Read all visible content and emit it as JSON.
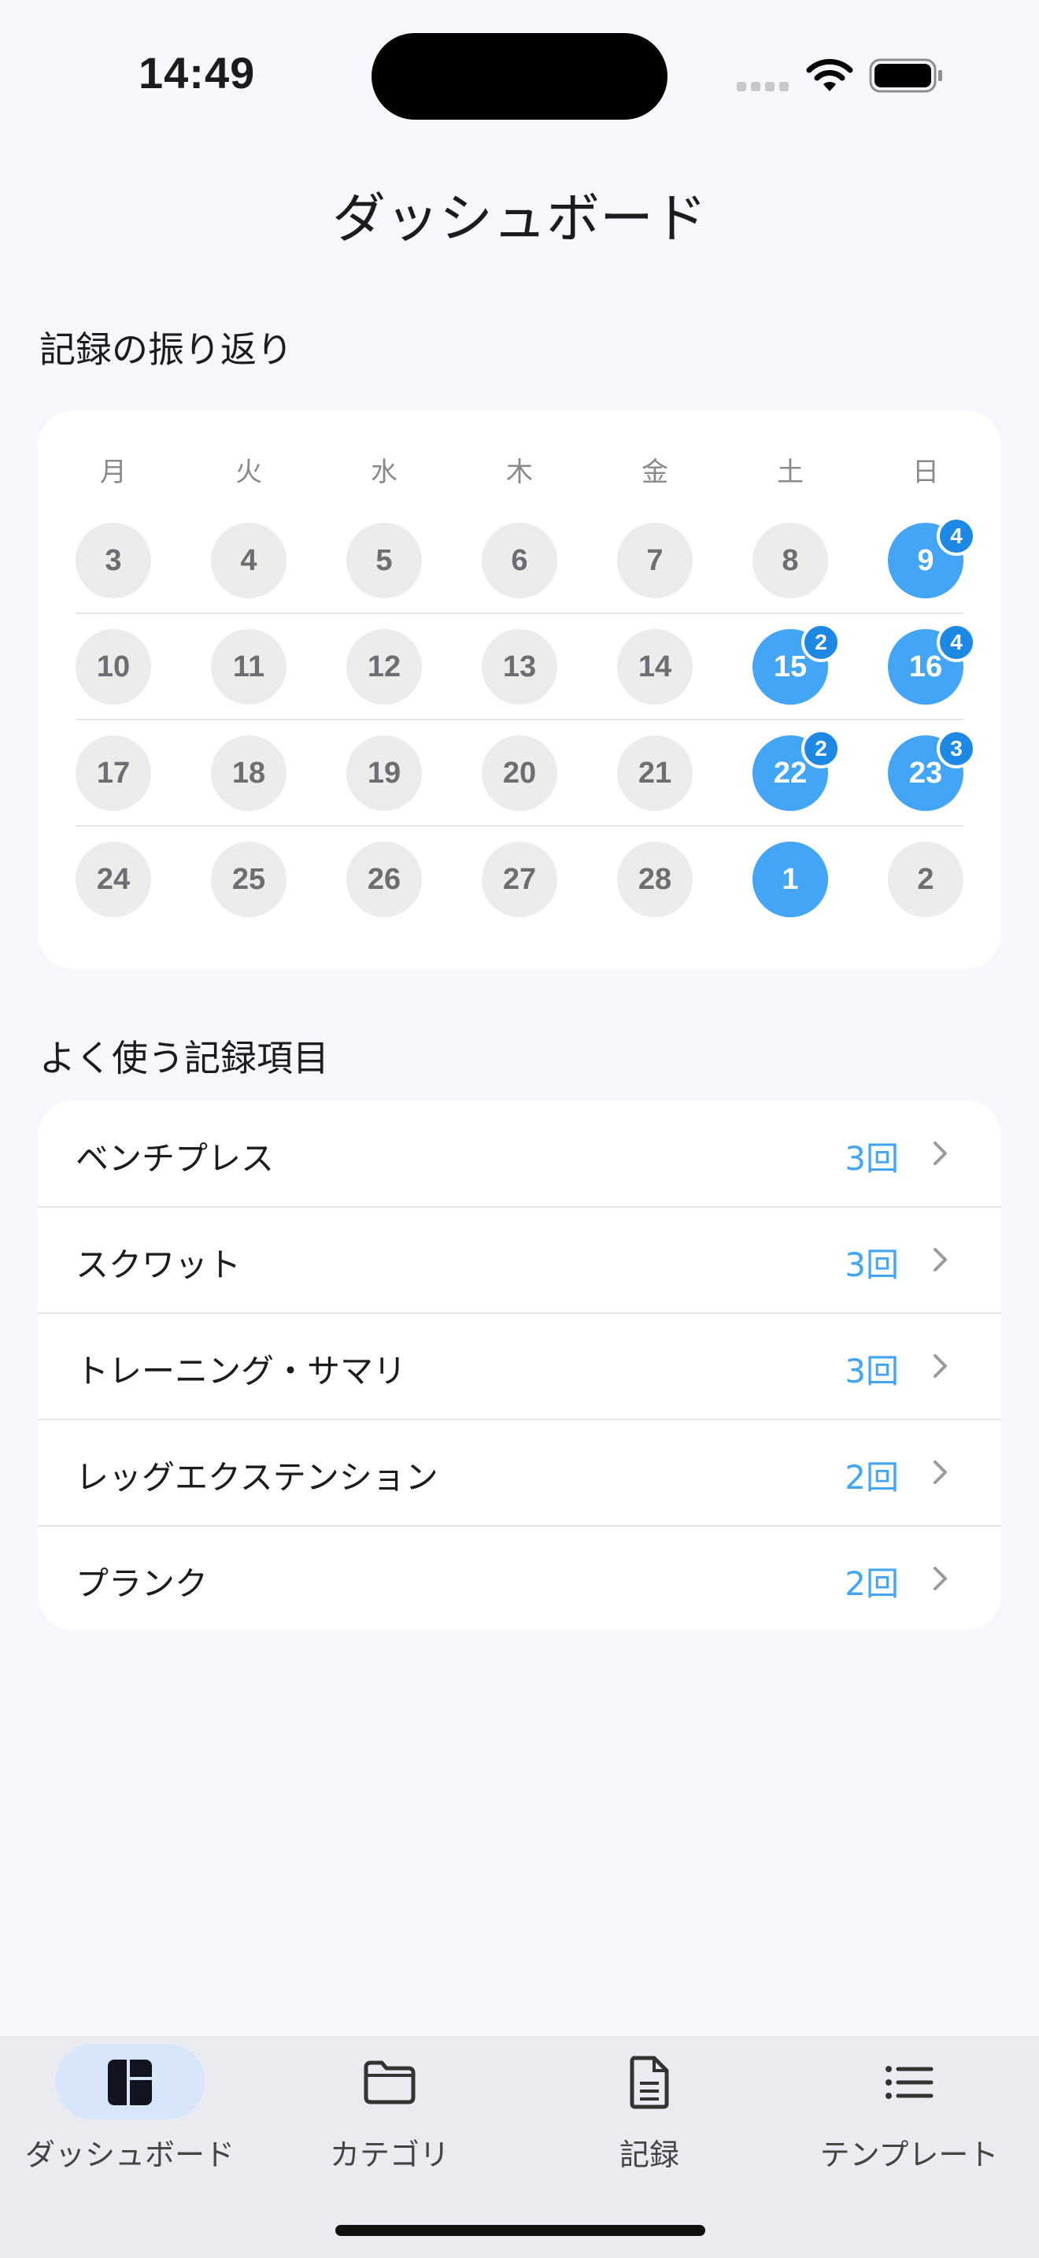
{
  "status_bar": {
    "time": "14:49"
  },
  "header": {
    "title": "ダッシュボード"
  },
  "review": {
    "title": "記録の振り返り",
    "weekdays": [
      "月",
      "火",
      "水",
      "木",
      "金",
      "土",
      "日"
    ],
    "weeks": [
      [
        {
          "day": "3"
        },
        {
          "day": "4"
        },
        {
          "day": "5"
        },
        {
          "day": "6"
        },
        {
          "day": "7"
        },
        {
          "day": "8"
        },
        {
          "day": "9",
          "active": true,
          "count": "4"
        }
      ],
      [
        {
          "day": "10"
        },
        {
          "day": "11"
        },
        {
          "day": "12"
        },
        {
          "day": "13"
        },
        {
          "day": "14"
        },
        {
          "day": "15",
          "active": true,
          "count": "2"
        },
        {
          "day": "16",
          "active": true,
          "count": "4"
        }
      ],
      [
        {
          "day": "17"
        },
        {
          "day": "18"
        },
        {
          "day": "19"
        },
        {
          "day": "20"
        },
        {
          "day": "21"
        },
        {
          "day": "22",
          "active": true,
          "count": "2"
        },
        {
          "day": "23",
          "active": true,
          "count": "3"
        }
      ],
      [
        {
          "day": "24"
        },
        {
          "day": "25"
        },
        {
          "day": "26"
        },
        {
          "day": "27"
        },
        {
          "day": "28"
        },
        {
          "day": "1",
          "active": true
        },
        {
          "day": "2"
        }
      ]
    ]
  },
  "frequent": {
    "title": "よく使う記録項目",
    "items": [
      {
        "label": "ベンチプレス",
        "count": "3回"
      },
      {
        "label": "スクワット",
        "count": "3回"
      },
      {
        "label": "トレーニング・サマリ",
        "count": "3回"
      },
      {
        "label": "レッグエクステンション",
        "count": "2回"
      },
      {
        "label": "プランク",
        "count": "2回"
      }
    ]
  },
  "tabs": [
    {
      "label": "ダッシュボード",
      "icon": "dashboard-icon",
      "selected": true
    },
    {
      "label": "カテゴリ",
      "icon": "folder-icon"
    },
    {
      "label": "記録",
      "icon": "document-icon"
    },
    {
      "label": "テンプレート",
      "icon": "list-icon"
    }
  ],
  "colors": {
    "accent": "#42a5f5",
    "badge": "#1e88e5",
    "background": "#f5f7fc"
  }
}
